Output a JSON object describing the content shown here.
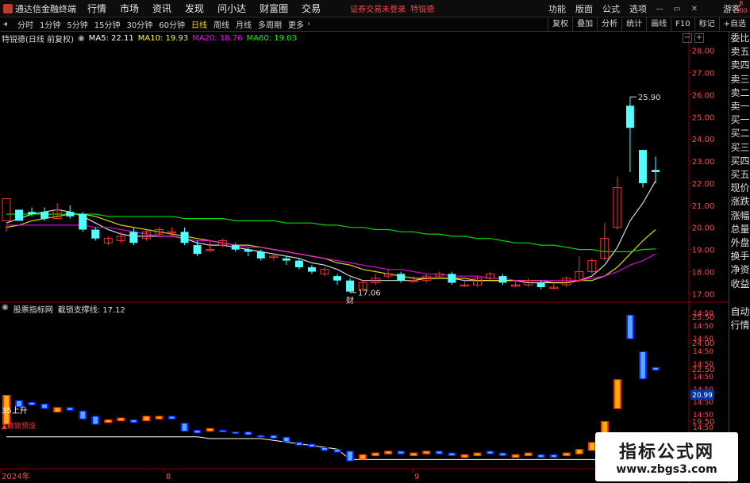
{
  "titlebar": {
    "app_name": "通达信金融终端",
    "menus": [
      "行情",
      "市场",
      "资讯",
      "发现",
      "问小达",
      "财富圈",
      "交易"
    ],
    "notice": "证券交易未登录",
    "stock_name": "特锐德",
    "right_menus": [
      "功能",
      "版面",
      "公式",
      "选项"
    ],
    "guest": "游客",
    "minimize": "—",
    "restore": "▭",
    "close": "✕",
    "badge_top": "R",
    "badge_bottom": "300"
  },
  "toolbar": {
    "periods": [
      "分时",
      "1分钟",
      "5分钟",
      "15分钟",
      "30分钟",
      "60分钟",
      "日线",
      "周线",
      "月线",
      "多周期",
      "更多"
    ],
    "active_period": "日线",
    "right_buttons": [
      "复权",
      "叠加",
      "分析",
      "统计",
      "画线",
      "F10",
      "标记",
      "+自选"
    ]
  },
  "info": {
    "stock_label": "特锐德(日线 前复权)",
    "ma5": "MA5: 22.11",
    "ma10": "MA10: 19.93",
    "ma20": "MA20: 18.76",
    "ma60": "MA60: 19.03",
    "ma5_color": "#ffffff",
    "ma10_color": "#ffff00",
    "ma20_color": "#ff00ff",
    "ma60_color": "#00ff00"
  },
  "lower_info": {
    "indicator": "股票指标网",
    "name": "截锁支撑线: 17.12"
  },
  "annotations": {
    "high_label": "25.90",
    "low_label": "17.06",
    "fin_marker": "财",
    "up_label": "35上升",
    "warn_label": "▲截锁预设",
    "current_price": "20.99"
  },
  "x_labels": [
    "2024年",
    "8",
    "9"
  ],
  "price_axis": [
    "28.00",
    "27.00",
    "26.00",
    "25.00",
    "24.00",
    "23.00",
    "22.00",
    "21.00",
    "20.00",
    "19.00",
    "18.00",
    "17.00"
  ],
  "lower_axis": [
    "25.50",
    "24.00",
    "22.50",
    "21.00",
    "19.50"
  ],
  "lower_axis_time": [
    "14:50",
    "14:50",
    "14:50",
    "14:50",
    "14:50",
    "14:50",
    "14:50",
    "14:50",
    "14:50",
    "14:50",
    "14:50",
    "14:50",
    "14:50"
  ],
  "right_panel": {
    "top_items": [
      "委比",
      "卖五",
      "卖四",
      "卖三",
      "卖二",
      "卖一",
      "买一",
      "买二",
      "买三",
      "买四",
      "买五",
      "现价",
      "涨跌",
      "涨幅",
      "总量",
      "外盘",
      "换手",
      "净资",
      "收益"
    ],
    "bottom_items": [
      "自动",
      "行情"
    ]
  },
  "watermark": {
    "title": "指标公式网",
    "url": "www.zbgs3.com"
  },
  "colors": {
    "up": "#ff3232",
    "down": "#54ffff",
    "ma5": "#ffffff",
    "ma10": "#ffff00",
    "ma20": "#ff00ff",
    "ma60": "#00ff00"
  },
  "candles": [
    [
      20.3,
      21.3,
      20.1,
      19.8
    ],
    [
      20.8,
      20.3,
      20.8,
      20.6
    ],
    [
      20.7,
      20.6,
      20.9,
      20.5
    ],
    [
      20.7,
      20.4,
      20.9,
      20.3
    ],
    [
      20.4,
      20.8,
      21.1,
      20.4
    ],
    [
      20.7,
      20.5,
      21.0,
      20.4
    ],
    [
      20.6,
      19.9,
      20.7,
      19.8
    ],
    [
      19.9,
      19.5,
      20.0,
      19.4
    ],
    [
      19.3,
      19.5,
      19.6,
      19.2
    ],
    [
      19.4,
      19.6,
      19.8,
      19.3
    ],
    [
      19.8,
      19.3,
      20.0,
      19.2
    ],
    [
      19.5,
      19.8,
      19.9,
      19.4
    ],
    [
      19.7,
      19.9,
      20.0,
      19.6
    ],
    [
      19.8,
      19.8,
      20.0,
      19.6
    ],
    [
      19.8,
      19.3,
      20.0,
      19.2
    ],
    [
      19.2,
      18.8,
      19.4,
      18.7
    ],
    [
      19.0,
      19.0,
      19.4,
      18.9
    ],
    [
      19.2,
      19.4,
      19.5,
      19.1
    ],
    [
      19.2,
      19.0,
      19.3,
      18.9
    ],
    [
      19.0,
      18.9,
      19.1,
      18.7
    ],
    [
      18.9,
      18.6,
      19.0,
      18.5
    ],
    [
      18.7,
      18.7,
      18.8,
      18.5
    ],
    [
      18.6,
      18.5,
      18.7,
      18.3
    ],
    [
      18.5,
      18.2,
      18.6,
      18.1
    ],
    [
      18.2,
      18.0,
      18.3,
      17.9
    ],
    [
      17.9,
      18.1,
      18.2,
      17.8
    ],
    [
      17.8,
      17.6,
      17.9,
      17.4
    ],
    [
      17.6,
      17.1,
      17.7,
      17.06
    ],
    [
      17.2,
      17.5,
      17.6,
      17.1
    ],
    [
      17.5,
      17.7,
      17.9,
      17.4
    ],
    [
      17.8,
      17.9,
      18.1,
      17.7
    ],
    [
      17.9,
      17.6,
      18.0,
      17.5
    ],
    [
      17.6,
      17.6,
      17.8,
      17.5
    ],
    [
      17.6,
      17.8,
      17.9,
      17.5
    ],
    [
      17.8,
      17.9,
      18.0,
      17.7
    ],
    [
      17.9,
      17.5,
      18.0,
      17.4
    ],
    [
      17.4,
      17.4,
      17.6,
      17.3
    ],
    [
      17.4,
      17.7,
      17.8,
      17.3
    ],
    [
      17.7,
      17.9,
      18.0,
      17.6
    ],
    [
      17.8,
      17.5,
      17.9,
      17.4
    ],
    [
      17.4,
      17.4,
      17.6,
      17.3
    ],
    [
      17.4,
      17.6,
      17.7,
      17.3
    ],
    [
      17.5,
      17.3,
      17.6,
      17.2
    ],
    [
      17.3,
      17.3,
      17.5,
      17.2
    ],
    [
      17.4,
      17.7,
      17.8,
      17.3
    ],
    [
      17.6,
      18.0,
      18.7,
      17.5
    ],
    [
      18.0,
      18.5,
      18.6,
      17.9
    ],
    [
      18.6,
      19.5,
      20.2,
      18.5
    ],
    [
      20.0,
      21.8,
      22.3,
      19.9
    ],
    [
      25.5,
      24.5,
      25.9,
      22.5
    ],
    [
      23.5,
      22.0,
      23.5,
      21.8
    ],
    [
      22.6,
      22.5,
      23.2,
      22.0
    ]
  ],
  "ma_lines": {
    "ma5": [
      20.2,
      20.4,
      20.6,
      20.7,
      20.8,
      20.7,
      20.5,
      20.2,
      19.9,
      19.7,
      19.6,
      19.6,
      19.6,
      19.6,
      19.5,
      19.3,
      19.2,
      19.2,
      19.1,
      19.0,
      18.9,
      18.8,
      18.7,
      18.6,
      18.4,
      18.3,
      18.1,
      17.8,
      17.6,
      17.6,
      17.6,
      17.6,
      17.6,
      17.7,
      17.7,
      17.7,
      17.6,
      17.6,
      17.6,
      17.6,
      17.6,
      17.5,
      17.5,
      17.5,
      17.5,
      17.6,
      17.8,
      18.3,
      19.1,
      20.3,
      21.1,
      22.1
    ],
    "ma10": [
      20.0,
      20.1,
      20.3,
      20.4,
      20.5,
      20.6,
      20.6,
      20.5,
      20.3,
      20.1,
      20.0,
      19.9,
      19.8,
      19.7,
      19.6,
      19.5,
      19.4,
      19.3,
      19.2,
      19.2,
      19.1,
      19.0,
      18.9,
      18.8,
      18.7,
      18.6,
      18.4,
      18.3,
      18.1,
      18.0,
      17.9,
      17.8,
      17.7,
      17.7,
      17.7,
      17.7,
      17.7,
      17.6,
      17.6,
      17.6,
      17.6,
      17.6,
      17.6,
      17.5,
      17.5,
      17.6,
      17.6,
      17.8,
      18.2,
      18.8,
      19.4,
      19.9
    ],
    "ma20": [
      20.1,
      20.1,
      20.1,
      20.1,
      20.1,
      20.1,
      20.1,
      20.0,
      20.0,
      19.9,
      19.8,
      19.7,
      19.6,
      19.6,
      19.5,
      19.4,
      19.4,
      19.3,
      19.2,
      19.1,
      19.1,
      19.0,
      18.9,
      18.8,
      18.7,
      18.6,
      18.5,
      18.4,
      18.3,
      18.2,
      18.1,
      18.1,
      18.0,
      17.9,
      17.9,
      17.8,
      17.8,
      17.8,
      17.7,
      17.7,
      17.6,
      17.6,
      17.6,
      17.6,
      17.6,
      17.6,
      17.7,
      17.8,
      18.0,
      18.3,
      18.5,
      18.8
    ],
    "ma60": [
      20.6,
      20.6,
      20.6,
      20.6,
      20.6,
      20.6,
      20.6,
      20.6,
      20.5,
      20.5,
      20.5,
      20.5,
      20.5,
      20.5,
      20.4,
      20.4,
      20.4,
      20.4,
      20.3,
      20.3,
      20.3,
      20.3,
      20.2,
      20.2,
      20.2,
      20.1,
      20.1,
      20.0,
      20.0,
      19.9,
      19.9,
      19.8,
      19.8,
      19.7,
      19.7,
      19.6,
      19.6,
      19.5,
      19.5,
      19.4,
      19.3,
      19.3,
      19.2,
      19.2,
      19.1,
      19.0,
      19.0,
      18.9,
      18.9,
      18.9,
      19.0,
      19.03
    ]
  },
  "lower_bars": [
    [
      21.0,
      19.3,
      1
    ],
    [
      20.7,
      20.3,
      0
    ],
    [
      20.6,
      20.4,
      0
    ],
    [
      20.5,
      20.2,
      0
    ],
    [
      20.3,
      20.0,
      1
    ],
    [
      20.3,
      20.1,
      0
    ],
    [
      20.1,
      19.6,
      0
    ],
    [
      19.8,
      19.3,
      0
    ],
    [
      19.6,
      19.4,
      1
    ],
    [
      19.7,
      19.5,
      1
    ],
    [
      19.6,
      19.4,
      0
    ],
    [
      19.8,
      19.5,
      1
    ],
    [
      19.8,
      19.6,
      1
    ],
    [
      19.8,
      19.6,
      0
    ],
    [
      19.4,
      18.9,
      0
    ],
    [
      19.0,
      18.8,
      0
    ],
    [
      19.1,
      18.9,
      1
    ],
    [
      19.0,
      18.9,
      0
    ],
    [
      18.9,
      18.8,
      0
    ],
    [
      18.9,
      18.7,
      0
    ],
    [
      18.7,
      18.6,
      0
    ],
    [
      18.7,
      18.5,
      0
    ],
    [
      18.6,
      18.3,
      0
    ],
    [
      18.3,
      18.1,
      0
    ],
    [
      18.2,
      18.0,
      0
    ],
    [
      18.0,
      17.8,
      0
    ],
    [
      17.9,
      17.7,
      0
    ],
    [
      17.8,
      17.2,
      0
    ],
    [
      17.6,
      17.3,
      1
    ],
    [
      17.7,
      17.5,
      1
    ],
    [
      17.8,
      17.6,
      1
    ],
    [
      17.8,
      17.6,
      0
    ],
    [
      17.7,
      17.5,
      1
    ],
    [
      17.8,
      17.6,
      1
    ],
    [
      17.8,
      17.6,
      0
    ],
    [
      17.7,
      17.5,
      0
    ],
    [
      17.6,
      17.4,
      1
    ],
    [
      17.7,
      17.5,
      1
    ],
    [
      17.8,
      17.6,
      0
    ],
    [
      17.7,
      17.5,
      0
    ],
    [
      17.6,
      17.4,
      1
    ],
    [
      17.7,
      17.5,
      1
    ],
    [
      17.6,
      17.4,
      0
    ],
    [
      17.6,
      17.4,
      0
    ],
    [
      17.7,
      17.5,
      1
    ],
    [
      17.9,
      17.6,
      1
    ],
    [
      18.3,
      17.8,
      1
    ],
    [
      19.5,
      18.5,
      1
    ],
    [
      21.9,
      20.2,
      1
    ],
    [
      25.6,
      24.2,
      0
    ],
    [
      23.5,
      21.9,
      0
    ],
    [
      22.6,
      22.4,
      0
    ]
  ],
  "lower_support_line": [
    18.6,
    18.6,
    18.6,
    18.6,
    18.6,
    18.6,
    18.6,
    18.6,
    18.6,
    18.6,
    18.6,
    18.6,
    18.6,
    18.6,
    18.6,
    18.6,
    18.5,
    18.5,
    18.5,
    18.5,
    18.5,
    18.4,
    18.3,
    18.2,
    18.1,
    18.0,
    17.9,
    17.3,
    17.3,
    17.3,
    17.3,
    17.3,
    17.3,
    17.3,
    17.3,
    17.3,
    17.3,
    17.3,
    17.3,
    17.3,
    17.3,
    17.3,
    17.3,
    17.3,
    17.3,
    17.3,
    17.3,
    17.3,
    17.3,
    17.3,
    17.3,
    17.3
  ]
}
